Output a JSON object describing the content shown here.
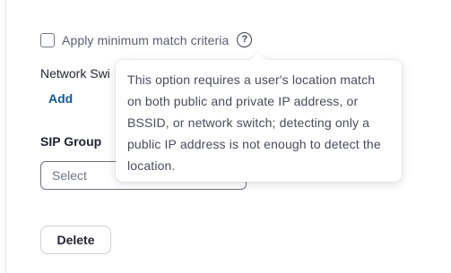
{
  "min_match": {
    "checkbox_label": "Apply minimum match criteria",
    "checked": false,
    "help_glyph": "?"
  },
  "network_switch": {
    "label": "Network Swi",
    "add_label": "Add"
  },
  "sip_group": {
    "label": "SIP Group",
    "select_value": "Select"
  },
  "delete_label": "Delete",
  "tooltip": {
    "text": "This option requires a user's location match on both public and private IP address, or BSSID, or network switch; detecting only a public IP address is not enough to detect the location."
  },
  "colors": {
    "link": "#0e5a99",
    "text": "#232333"
  }
}
